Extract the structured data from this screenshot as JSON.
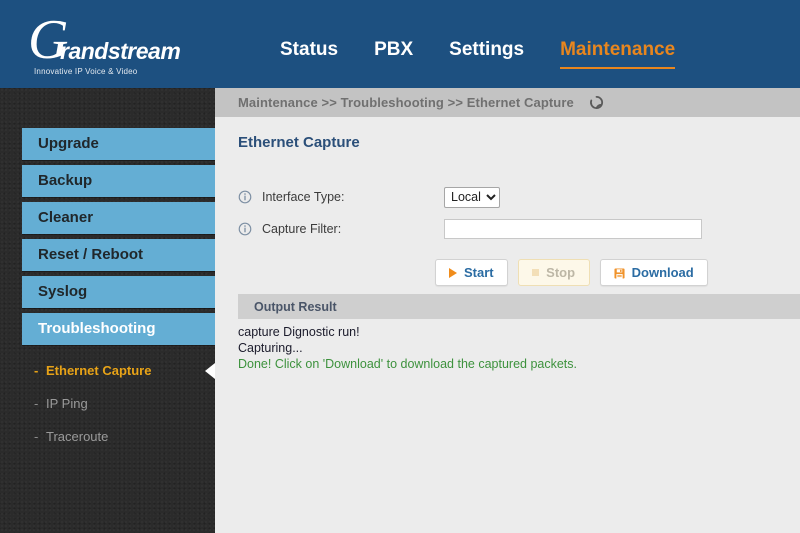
{
  "header": {
    "logo_mark": "G",
    "logo_word": "randstream",
    "logo_tagline": "Innovative IP Voice & Video",
    "nav": [
      {
        "label": "Status",
        "active": false
      },
      {
        "label": "PBX",
        "active": false
      },
      {
        "label": "Settings",
        "active": false
      },
      {
        "label": "Maintenance",
        "active": true
      }
    ],
    "background_color": "#1d5080",
    "accent_color": "#e8861e"
  },
  "sidebar": {
    "items": [
      {
        "label": "Upgrade"
      },
      {
        "label": "Backup"
      },
      {
        "label": "Cleaner"
      },
      {
        "label": "Reset / Reboot"
      },
      {
        "label": "Syslog"
      },
      {
        "label": "Troubleshooting"
      }
    ],
    "sub_items": [
      {
        "label": "Ethernet Capture",
        "marker": "-",
        "active": true
      },
      {
        "label": "IP Ping",
        "marker": "-",
        "active": false
      },
      {
        "label": "Traceroute",
        "marker": "-",
        "active": false
      }
    ],
    "active_item_color": "#e8a317"
  },
  "breadcrumb": {
    "text": "Maintenance >> Troubleshooting >> Ethernet Capture",
    "refresh_icon": "refresh-icon"
  },
  "main": {
    "title": "Ethernet Capture",
    "fields": {
      "interface_type": {
        "label": "Interface Type:",
        "info_icon": "info-icon",
        "value": "Local",
        "options": [
          "Local"
        ]
      },
      "capture_filter": {
        "label": "Capture Filter:",
        "info_icon": "info-icon",
        "value": "",
        "placeholder": ""
      }
    },
    "buttons": {
      "start": {
        "label": "Start",
        "icon": "play-icon",
        "disabled": false
      },
      "stop": {
        "label": "Stop",
        "icon": "stop-icon",
        "disabled": true
      },
      "download": {
        "label": "Download",
        "icon": "save-icon",
        "disabled": false
      }
    },
    "output": {
      "header": "Output Result",
      "lines": [
        {
          "text": "capture Dignostic run!",
          "color": "#1b1b2b"
        },
        {
          "text": "Capturing...",
          "color": "#1b1b2b"
        },
        {
          "text": "Done! Click on 'Download' to download the captured packets.",
          "color": "#3d923d"
        }
      ]
    }
  }
}
